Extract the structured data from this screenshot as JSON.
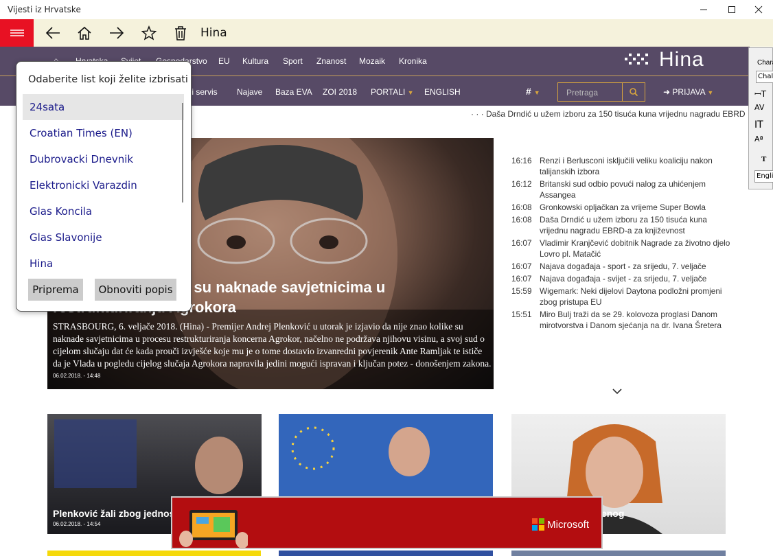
{
  "window": {
    "title": "Vijesti iz Hrvatske"
  },
  "appbar": {
    "title": "Hina"
  },
  "nav1": [
    "Hrvatska",
    "Svijet",
    "Gospodarstvo",
    "EU",
    "Kultura",
    "Sport",
    "Znanost",
    "Mozaik",
    "Kronika"
  ],
  "nav2": [
    "...ovni servis",
    "Najave",
    "Baza EVA",
    "ZOI 2018",
    "PORTALI",
    "ENGLISH"
  ],
  "logo": "Hina",
  "search": {
    "placeholder": "Pretraga"
  },
  "hash_label": "#",
  "login_label": "PRIJAVA",
  "ticker": "· · · Daša Drndić u užem izboru za 150 tisuća kuna vrijednu nagradu EBRD",
  "hero": {
    "title": "...o saznanja kolike su naknade savjetnicima u restrukturiranju Agrokora",
    "text": "STRASBOURG, 6. veljače 2018. (Hina) - Premijer Andrej Plenković u utorak je izjavio da nije znao kolike su naknade savjetnicima u procesu restrukturiranja koncerna Agrokor, načelno ne podržava njihovu visinu, a svoj sud o cijelom slučaju dat će kada prouči izvješće koje mu je o tome dostavio izvanredni povjerenik Ante Ramljak te ističe da je Vlada u pogledu cijelog slučaja Agrokora napravila jedini mogući ispravan i ključan potez  - donošenjem zakona.",
    "date": "06.02.2018. - 14:48"
  },
  "news": [
    {
      "time": "16:16",
      "title": "Renzi i Berlusconi isključili veliku koaliciju nakon talijanskih izbora"
    },
    {
      "time": "16:12",
      "title": "Britanski sud odbio povući nalog za uhićenjem Assangea"
    },
    {
      "time": "16:08",
      "title": "Gronkowski opljačkan za vrijeme Super Bowla"
    },
    {
      "time": "16:08",
      "title": "Daša Drndić u užem izboru za 150 tisuća kuna vrijednu nagradu EBRD-a za književnost"
    },
    {
      "time": "16:07",
      "title": "Vladimir Kranjčević dobitnik Nagrade za životno djelo Lovro pl. Matačić"
    },
    {
      "time": "16:07",
      "title": "Najava događaja - sport - za srijedu, 7. veljače"
    },
    {
      "time": "16:07",
      "title": "Najava događaja - svijet - za srijedu, 7. veljače"
    },
    {
      "time": "15:59",
      "title": "Wigemark: Neki dijelovi Daytona podložni promjeni zbog pristupa EU"
    },
    {
      "time": "15:51",
      "title": "Miro Bulj traži da se 29. kolovoza proglasi Danom mirotvorstva i Danom sjećanja na dr. Ivana Šretera"
    }
  ],
  "cards": [
    {
      "title": "Plenković žali zbog jednos... poteza",
      "date": "06.02.2018. - 14:54"
    },
    {
      "title": "",
      "date": ""
    },
    {
      "title": "...ođena ovrha malenog",
      "date": ""
    }
  ],
  "ad": {
    "brand": "Microsoft"
  },
  "popup": {
    "heading": "Odaberite list koji želite izbrisati",
    "items": [
      "24sata",
      "Croatian Times (EN)",
      "Dubrovacki Dnevnik",
      "Elektronicki Varazdin",
      "Glas Koncila",
      "Glas Slavonije",
      "Hina"
    ],
    "btn_primary": "Priprema",
    "btn_secondary": "Obnoviti popis"
  },
  "rpanel": {
    "label1": "Chara",
    "label2": "Chal",
    "label3": "Engli"
  },
  "colors": {
    "accent_red": "#e81123",
    "nav_bg": "#574a66",
    "gold": "#d8a53e",
    "appbar_bg": "#f5f2dc"
  }
}
